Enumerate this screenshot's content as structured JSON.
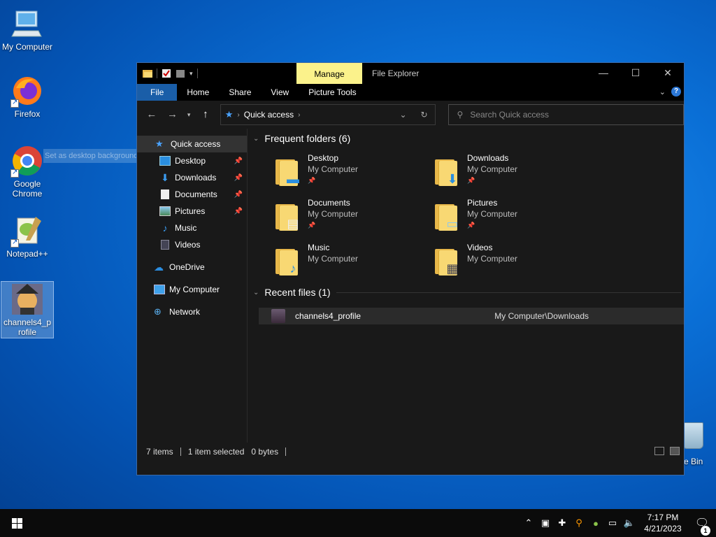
{
  "desktop": {
    "icons": [
      {
        "label": "My Computer"
      },
      {
        "label": "Firefox"
      },
      {
        "label": "Google Chrome"
      },
      {
        "label": "Notepad++"
      },
      {
        "label": "channels4_profile"
      }
    ],
    "drag_ghost_text": "Set as desktop background",
    "recycle_bin_label": "e Bin"
  },
  "window": {
    "manage_tab": "Manage",
    "title": "File Explorer",
    "controls": {
      "minimize": "—",
      "maximize": "☐",
      "close": "✕"
    },
    "ribbon_tabs": [
      "File",
      "Home",
      "Share",
      "View",
      "Picture Tools"
    ],
    "address": {
      "location": "Quick access"
    },
    "search": {
      "placeholder": "Search Quick access"
    },
    "nav": [
      {
        "label": "Quick access"
      },
      {
        "label": "Desktop"
      },
      {
        "label": "Downloads"
      },
      {
        "label": "Documents"
      },
      {
        "label": "Pictures"
      },
      {
        "label": "Music"
      },
      {
        "label": "Videos"
      },
      {
        "label": "OneDrive"
      },
      {
        "label": "My Computer"
      },
      {
        "label": "Network"
      }
    ],
    "frequent": {
      "header": "Frequent folders (6)",
      "items": [
        {
          "name": "Desktop",
          "location": "My Computer",
          "pinned": true
        },
        {
          "name": "Downloads",
          "location": "My Computer",
          "pinned": true
        },
        {
          "name": "Documents",
          "location": "My Computer",
          "pinned": true
        },
        {
          "name": "Pictures",
          "location": "My Computer",
          "pinned": true
        },
        {
          "name": "Music",
          "location": "My Computer",
          "pinned": false
        },
        {
          "name": "Videos",
          "location": "My Computer",
          "pinned": false
        }
      ]
    },
    "recent": {
      "header": "Recent files (1)",
      "items": [
        {
          "name": "channels4_profile",
          "path": "My Computer\\Downloads"
        }
      ]
    },
    "status": {
      "items": "7 items",
      "selected": "1 item selected",
      "size": "0 bytes"
    }
  },
  "taskbar": {
    "time": "7:17 PM",
    "date": "4/21/2023",
    "notification_count": "1"
  }
}
